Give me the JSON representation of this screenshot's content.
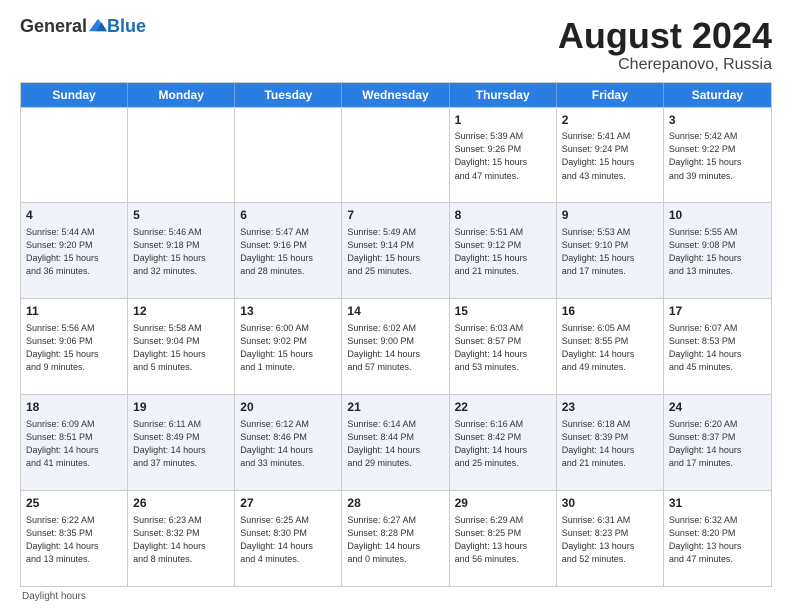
{
  "header": {
    "logo_general": "General",
    "logo_blue": "Blue",
    "month_title": "August 2024",
    "subtitle": "Cherepanovo, Russia"
  },
  "weekdays": [
    "Sunday",
    "Monday",
    "Tuesday",
    "Wednesday",
    "Thursday",
    "Friday",
    "Saturday"
  ],
  "footer": "Daylight hours",
  "rows": [
    {
      "alt": false,
      "cells": [
        {
          "day": "",
          "lines": []
        },
        {
          "day": "",
          "lines": []
        },
        {
          "day": "",
          "lines": []
        },
        {
          "day": "",
          "lines": []
        },
        {
          "day": "1",
          "lines": [
            "Sunrise: 5:39 AM",
            "Sunset: 9:26 PM",
            "Daylight: 15 hours",
            "and 47 minutes."
          ]
        },
        {
          "day": "2",
          "lines": [
            "Sunrise: 5:41 AM",
            "Sunset: 9:24 PM",
            "Daylight: 15 hours",
            "and 43 minutes."
          ]
        },
        {
          "day": "3",
          "lines": [
            "Sunrise: 5:42 AM",
            "Sunset: 9:22 PM",
            "Daylight: 15 hours",
            "and 39 minutes."
          ]
        }
      ]
    },
    {
      "alt": true,
      "cells": [
        {
          "day": "4",
          "lines": [
            "Sunrise: 5:44 AM",
            "Sunset: 9:20 PM",
            "Daylight: 15 hours",
            "and 36 minutes."
          ]
        },
        {
          "day": "5",
          "lines": [
            "Sunrise: 5:46 AM",
            "Sunset: 9:18 PM",
            "Daylight: 15 hours",
            "and 32 minutes."
          ]
        },
        {
          "day": "6",
          "lines": [
            "Sunrise: 5:47 AM",
            "Sunset: 9:16 PM",
            "Daylight: 15 hours",
            "and 28 minutes."
          ]
        },
        {
          "day": "7",
          "lines": [
            "Sunrise: 5:49 AM",
            "Sunset: 9:14 PM",
            "Daylight: 15 hours",
            "and 25 minutes."
          ]
        },
        {
          "day": "8",
          "lines": [
            "Sunrise: 5:51 AM",
            "Sunset: 9:12 PM",
            "Daylight: 15 hours",
            "and 21 minutes."
          ]
        },
        {
          "day": "9",
          "lines": [
            "Sunrise: 5:53 AM",
            "Sunset: 9:10 PM",
            "Daylight: 15 hours",
            "and 17 minutes."
          ]
        },
        {
          "day": "10",
          "lines": [
            "Sunrise: 5:55 AM",
            "Sunset: 9:08 PM",
            "Daylight: 15 hours",
            "and 13 minutes."
          ]
        }
      ]
    },
    {
      "alt": false,
      "cells": [
        {
          "day": "11",
          "lines": [
            "Sunrise: 5:56 AM",
            "Sunset: 9:06 PM",
            "Daylight: 15 hours",
            "and 9 minutes."
          ]
        },
        {
          "day": "12",
          "lines": [
            "Sunrise: 5:58 AM",
            "Sunset: 9:04 PM",
            "Daylight: 15 hours",
            "and 5 minutes."
          ]
        },
        {
          "day": "13",
          "lines": [
            "Sunrise: 6:00 AM",
            "Sunset: 9:02 PM",
            "Daylight: 15 hours",
            "and 1 minute."
          ]
        },
        {
          "day": "14",
          "lines": [
            "Sunrise: 6:02 AM",
            "Sunset: 9:00 PM",
            "Daylight: 14 hours",
            "and 57 minutes."
          ]
        },
        {
          "day": "15",
          "lines": [
            "Sunrise: 6:03 AM",
            "Sunset: 8:57 PM",
            "Daylight: 14 hours",
            "and 53 minutes."
          ]
        },
        {
          "day": "16",
          "lines": [
            "Sunrise: 6:05 AM",
            "Sunset: 8:55 PM",
            "Daylight: 14 hours",
            "and 49 minutes."
          ]
        },
        {
          "day": "17",
          "lines": [
            "Sunrise: 6:07 AM",
            "Sunset: 8:53 PM",
            "Daylight: 14 hours",
            "and 45 minutes."
          ]
        }
      ]
    },
    {
      "alt": true,
      "cells": [
        {
          "day": "18",
          "lines": [
            "Sunrise: 6:09 AM",
            "Sunset: 8:51 PM",
            "Daylight: 14 hours",
            "and 41 minutes."
          ]
        },
        {
          "day": "19",
          "lines": [
            "Sunrise: 6:11 AM",
            "Sunset: 8:49 PM",
            "Daylight: 14 hours",
            "and 37 minutes."
          ]
        },
        {
          "day": "20",
          "lines": [
            "Sunrise: 6:12 AM",
            "Sunset: 8:46 PM",
            "Daylight: 14 hours",
            "and 33 minutes."
          ]
        },
        {
          "day": "21",
          "lines": [
            "Sunrise: 6:14 AM",
            "Sunset: 8:44 PM",
            "Daylight: 14 hours",
            "and 29 minutes."
          ]
        },
        {
          "day": "22",
          "lines": [
            "Sunrise: 6:16 AM",
            "Sunset: 8:42 PM",
            "Daylight: 14 hours",
            "and 25 minutes."
          ]
        },
        {
          "day": "23",
          "lines": [
            "Sunrise: 6:18 AM",
            "Sunset: 8:39 PM",
            "Daylight: 14 hours",
            "and 21 minutes."
          ]
        },
        {
          "day": "24",
          "lines": [
            "Sunrise: 6:20 AM",
            "Sunset: 8:37 PM",
            "Daylight: 14 hours",
            "and 17 minutes."
          ]
        }
      ]
    },
    {
      "alt": false,
      "cells": [
        {
          "day": "25",
          "lines": [
            "Sunrise: 6:22 AM",
            "Sunset: 8:35 PM",
            "Daylight: 14 hours",
            "and 13 minutes."
          ]
        },
        {
          "day": "26",
          "lines": [
            "Sunrise: 6:23 AM",
            "Sunset: 8:32 PM",
            "Daylight: 14 hours",
            "and 8 minutes."
          ]
        },
        {
          "day": "27",
          "lines": [
            "Sunrise: 6:25 AM",
            "Sunset: 8:30 PM",
            "Daylight: 14 hours",
            "and 4 minutes."
          ]
        },
        {
          "day": "28",
          "lines": [
            "Sunrise: 6:27 AM",
            "Sunset: 8:28 PM",
            "Daylight: 14 hours",
            "and 0 minutes."
          ]
        },
        {
          "day": "29",
          "lines": [
            "Sunrise: 6:29 AM",
            "Sunset: 8:25 PM",
            "Daylight: 13 hours",
            "and 56 minutes."
          ]
        },
        {
          "day": "30",
          "lines": [
            "Sunrise: 6:31 AM",
            "Sunset: 8:23 PM",
            "Daylight: 13 hours",
            "and 52 minutes."
          ]
        },
        {
          "day": "31",
          "lines": [
            "Sunrise: 6:32 AM",
            "Sunset: 8:20 PM",
            "Daylight: 13 hours",
            "and 47 minutes."
          ]
        }
      ]
    }
  ]
}
